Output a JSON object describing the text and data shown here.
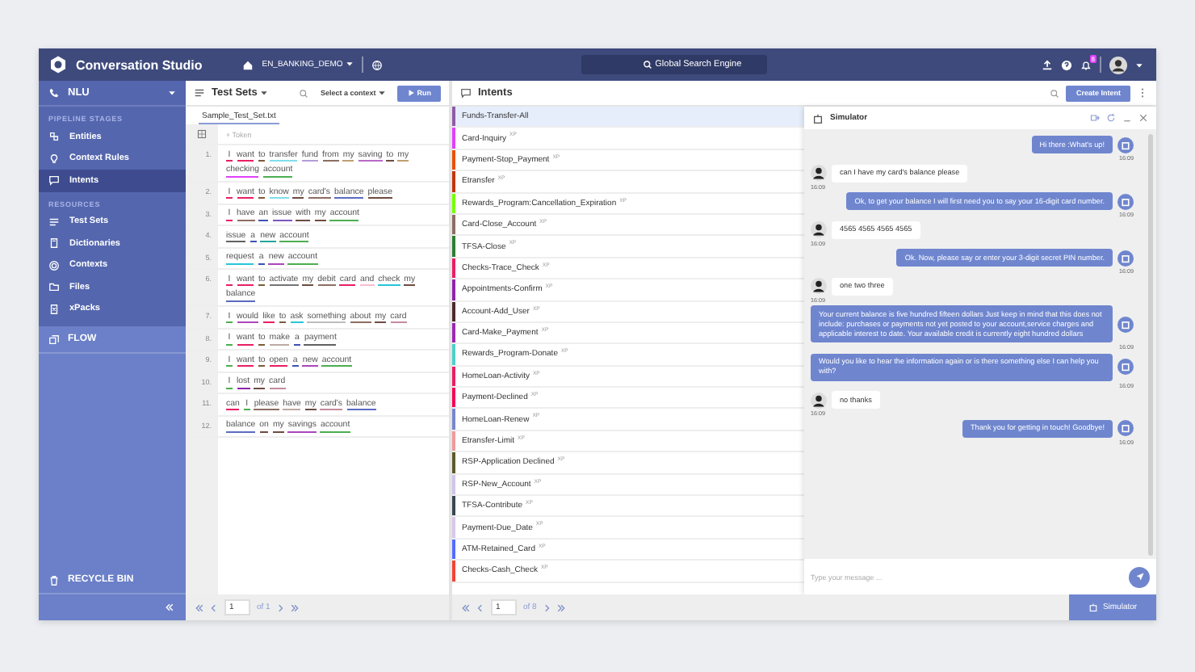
{
  "app": {
    "title": "Conversation Studio",
    "project": "EN_BANKING_DEMO",
    "search": {
      "placeholder": "Global Search Engine"
    },
    "notifications": "8"
  },
  "sidebar": {
    "module": "NLU",
    "sections": [
      {
        "heading": "PIPELINE STAGES",
        "items": [
          {
            "label": "Entities",
            "kind": "entities",
            "selected": false
          },
          {
            "label": "Context Rules",
            "kind": "rules",
            "selected": false
          },
          {
            "label": "Intents",
            "kind": "intents",
            "selected": true
          }
        ]
      },
      {
        "heading": "RESOURCES",
        "items": [
          {
            "label": "Test Sets",
            "kind": "testsets",
            "selected": false
          },
          {
            "label": "Dictionaries",
            "kind": "dictionaries",
            "selected": false
          },
          {
            "label": "Contexts",
            "kind": "contexts",
            "selected": false
          },
          {
            "label": "Files",
            "kind": "files",
            "selected": false
          },
          {
            "label": "xPacks",
            "kind": "xpacks",
            "selected": false
          }
        ]
      }
    ],
    "flow": "FLOW",
    "recycle_bin": "RECYCLE BIN"
  },
  "test_sets": {
    "title": "Test Sets",
    "context": "Select a context",
    "run": "Run",
    "file_tab": "Sample_Test_Set.txt",
    "token": {
      "placeholder": "+ Token"
    },
    "rows": [
      {
        "number": "1.",
        "tokens": [
          {
            "text": "I",
            "color": "#e91e63"
          },
          {
            "text": "want",
            "color": "#e91e63"
          },
          {
            "text": "to",
            "color": "#7b5b3a"
          },
          {
            "text": "transfer",
            "color": "#80deea"
          },
          {
            "text": "fund",
            "color": "#b39ddb"
          },
          {
            "text": "from",
            "color": "#8d6e63"
          },
          {
            "text": "my",
            "color": "#c0a070"
          },
          {
            "text": "saving",
            "color": "#ba68c8"
          },
          {
            "text": "to",
            "color": "#6d4c41"
          },
          {
            "text": "my",
            "color": "#c0a070"
          },
          {
            "text": "checking",
            "color": "#e040fb"
          },
          {
            "text": "account",
            "color": "#4caf50"
          }
        ]
      },
      {
        "number": "2.",
        "tokens": [
          {
            "text": "I",
            "color": "#e91e63"
          },
          {
            "text": "want",
            "color": "#e91e63"
          },
          {
            "text": "to",
            "color": "#7b5b3a"
          },
          {
            "text": "know",
            "color": "#80deea"
          },
          {
            "text": "my",
            "color": "#6d4c41"
          },
          {
            "text": "card's",
            "color": "#8d6e63"
          },
          {
            "text": "balance",
            "color": "#5c6bc0"
          },
          {
            "text": "please",
            "color": "#6d4c41"
          }
        ]
      },
      {
        "number": "3.",
        "tokens": [
          {
            "text": "I",
            "color": "#e91e63"
          },
          {
            "text": "have",
            "color": "#8d6e63"
          },
          {
            "text": "an",
            "color": "#3f51b5"
          },
          {
            "text": "issue",
            "color": "#7e57c2"
          },
          {
            "text": "with",
            "color": "#6d4c41"
          },
          {
            "text": "my",
            "color": "#6d4c41"
          },
          {
            "text": "account",
            "color": "#4caf50"
          }
        ]
      },
      {
        "number": "4.",
        "tokens": [
          {
            "text": "issue",
            "color": "#616161"
          },
          {
            "text": "a",
            "color": "#3f51b5"
          },
          {
            "text": "new",
            "color": "#26a69a"
          },
          {
            "text": "account",
            "color": "#4caf50"
          }
        ]
      },
      {
        "number": "5.",
        "tokens": [
          {
            "text": "request",
            "color": "#26c6da"
          },
          {
            "text": "a",
            "color": "#3f51b5"
          },
          {
            "text": "new",
            "color": "#ab47bc"
          },
          {
            "text": "account",
            "color": "#4caf50"
          }
        ]
      },
      {
        "number": "6.",
        "tokens": [
          {
            "text": "I",
            "color": "#e91e63"
          },
          {
            "text": "want",
            "color": "#e91e63"
          },
          {
            "text": "to",
            "color": "#7b5b3a"
          },
          {
            "text": "activate",
            "color": "#757575"
          },
          {
            "text": "my",
            "color": "#6d4c41"
          },
          {
            "text": "debit",
            "color": "#8d6e63"
          },
          {
            "text": "card",
            "color": "#e91e63"
          },
          {
            "text": "and",
            "color": "#f8bbd0"
          },
          {
            "text": "check",
            "color": "#26c6da"
          },
          {
            "text": "my",
            "color": "#6d4c41"
          },
          {
            "text": "balance",
            "color": "#5c6bc0"
          }
        ]
      },
      {
        "number": "7.",
        "tokens": [
          {
            "text": "I",
            "color": "#4caf50"
          },
          {
            "text": "would",
            "color": "#ab47bc"
          },
          {
            "text": "like",
            "color": "#e91e63"
          },
          {
            "text": "to",
            "color": "#7b5b3a"
          },
          {
            "text": "ask",
            "color": "#26c6da"
          },
          {
            "text": "something",
            "color": "#bdbdbd"
          },
          {
            "text": "about",
            "color": "#8d6e63"
          },
          {
            "text": "my",
            "color": "#6d4c41"
          },
          {
            "text": "card",
            "color": "#c48b9f"
          }
        ]
      },
      {
        "number": "8.",
        "tokens": [
          {
            "text": "I",
            "color": "#4caf50"
          },
          {
            "text": "want",
            "color": "#e91e63"
          },
          {
            "text": "to",
            "color": "#7b5b3a"
          },
          {
            "text": "make",
            "color": "#bcaaa4"
          },
          {
            "text": "a",
            "color": "#3f51b5"
          },
          {
            "text": "payment",
            "color": "#616161"
          }
        ]
      },
      {
        "number": "9.",
        "tokens": [
          {
            "text": "I",
            "color": "#4caf50"
          },
          {
            "text": "want",
            "color": "#e91e63"
          },
          {
            "text": "to",
            "color": "#7b5b3a"
          },
          {
            "text": "open",
            "color": "#e91e63"
          },
          {
            "text": "a",
            "color": "#3f51b5"
          },
          {
            "text": "new",
            "color": "#ab47bc"
          },
          {
            "text": "account",
            "color": "#4caf50"
          }
        ]
      },
      {
        "number": "10.",
        "tokens": [
          {
            "text": "I",
            "color": "#4caf50"
          },
          {
            "text": "lost",
            "color": "#8e24aa"
          },
          {
            "text": "my",
            "color": "#6d4c41"
          },
          {
            "text": "card",
            "color": "#c48b9f"
          }
        ]
      },
      {
        "number": "11.",
        "tokens": [
          {
            "text": "can",
            "color": "#e91e63"
          },
          {
            "text": "I",
            "color": "#4caf50"
          },
          {
            "text": "please",
            "color": "#8d6e63"
          },
          {
            "text": "have",
            "color": "#bcaaa4"
          },
          {
            "text": "my",
            "color": "#6d4c41"
          },
          {
            "text": "card's",
            "color": "#c48b9f"
          },
          {
            "text": "balance",
            "color": "#5c6bc0"
          }
        ]
      },
      {
        "number": "12.",
        "tokens": [
          {
            "text": "balance",
            "color": "#5c6bc0"
          },
          {
            "text": "on",
            "color": "#6d4c41"
          },
          {
            "text": "my",
            "color": "#6d4c41"
          },
          {
            "text": "savings",
            "color": "#ab47bc"
          },
          {
            "text": "account",
            "color": "#4caf50"
          }
        ]
      }
    ],
    "pager": {
      "page": "1",
      "of": "of 1"
    }
  },
  "intents": {
    "title": "Intents",
    "create": "Create Intent",
    "items": [
      {
        "name": "Funds-Transfer-All",
        "color": "#8e5ba8",
        "selected": true
      },
      {
        "name": "Card-Inquiry",
        "tag": "XP",
        "color": "#e040fb",
        "selected": false
      },
      {
        "name": "Payment-Stop_Payment",
        "tag": "XP",
        "color": "#e65100",
        "selected": false
      },
      {
        "name": "Etransfer",
        "tag": "XP",
        "color": "#bf360c",
        "selected": false
      },
      {
        "name": "Rewards_Program:Cancellation_Expiration",
        "tag": "XP",
        "color": "#76ff03",
        "selected": false
      },
      {
        "name": "Card-Close_Account",
        "tag": "XP",
        "color": "#8d6e63",
        "selected": false
      },
      {
        "name": "TFSA-Close",
        "tag": "XP",
        "color": "#2e7d32",
        "selected": false
      },
      {
        "name": "Checks-Trace_Check",
        "tag": "XP",
        "color": "#e91e63",
        "selected": false
      },
      {
        "name": "Appointments-Confirm",
        "tag": "XP",
        "color": "#8e24aa",
        "selected": false
      },
      {
        "name": "Account-Add_User",
        "tag": "XP",
        "color": "#4e2a2a",
        "selected": false
      },
      {
        "name": "Card-Make_Payment",
        "tag": "XP",
        "color": "#9c27b0",
        "selected": false
      },
      {
        "name": "Rewards_Program-Donate",
        "tag": "XP",
        "color": "#4dd0c8",
        "selected": false
      },
      {
        "name": "HomeLoan-Activity",
        "tag": "XP",
        "color": "#e91e63",
        "selected": false
      },
      {
        "name": "Payment-Declined",
        "tag": "XP",
        "color": "#f50057",
        "selected": false
      },
      {
        "name": "HomeLoan-Renew",
        "tag": "XP",
        "color": "#7986cb",
        "selected": false
      },
      {
        "name": "Etransfer-Limit",
        "tag": "XP",
        "color": "#ef9a9a",
        "selected": false
      },
      {
        "name": "RSP-Application Declined",
        "tag": "XP",
        "color": "#5d5a2a",
        "selected": false
      },
      {
        "name": "RSP-New_Account",
        "tag": "XP",
        "color": "#d1c4e9",
        "selected": false
      },
      {
        "name": "TFSA-Contribute",
        "tag": "XP",
        "color": "#37474f",
        "selected": false
      },
      {
        "name": "Payment-Due_Date",
        "tag": "XP",
        "color": "#d7c8ea",
        "selected": false
      },
      {
        "name": "ATM-Retained_Card",
        "tag": "XP",
        "color": "#536dfe",
        "selected": false
      },
      {
        "name": "Checks-Cash_Check",
        "tag": "XP",
        "color": "#f44336",
        "selected": false
      }
    ],
    "pager": {
      "page": "1",
      "of": "of 8"
    }
  },
  "simulator": {
    "title": "Simulator",
    "messages": [
      {
        "kind": "bot",
        "text": "Hi there :What's up!",
        "time": "16:09"
      },
      {
        "kind": "user",
        "text": "can I have my card's balance please",
        "time": "16:09"
      },
      {
        "kind": "bot",
        "text": "Ok, to get your balance I will first need you to say your 16-digit card number.",
        "time": "16:09"
      },
      {
        "kind": "user",
        "text": "4565 4565 4565 4565",
        "time": "16:09"
      },
      {
        "kind": "bot",
        "text": "Ok. Now, please say or enter your 3-digit secret PIN number.",
        "time": "16:09"
      },
      {
        "kind": "user",
        "text": "one two three",
        "time": "16:09"
      },
      {
        "kind": "bot",
        "text": "Your current balance is five hundred fifteen dollars Just keep in mind that this does not include: purchases or payments not yet posted to your account,service charges and applicable interest to date. Your available credit is currently eight hundred dollars",
        "time": "16:09"
      },
      {
        "kind": "bot",
        "text": "Would you like to hear the information again or is there something else I can help you with?",
        "time": "16:09"
      },
      {
        "kind": "user",
        "text": "no thanks",
        "time": "16:09"
      },
      {
        "kind": "bot",
        "text": "Thank you for getting in touch! Goodbye!",
        "time": "16:09"
      }
    ],
    "input": {
      "placeholder": "Type your message ..."
    },
    "button": "Simulator"
  }
}
